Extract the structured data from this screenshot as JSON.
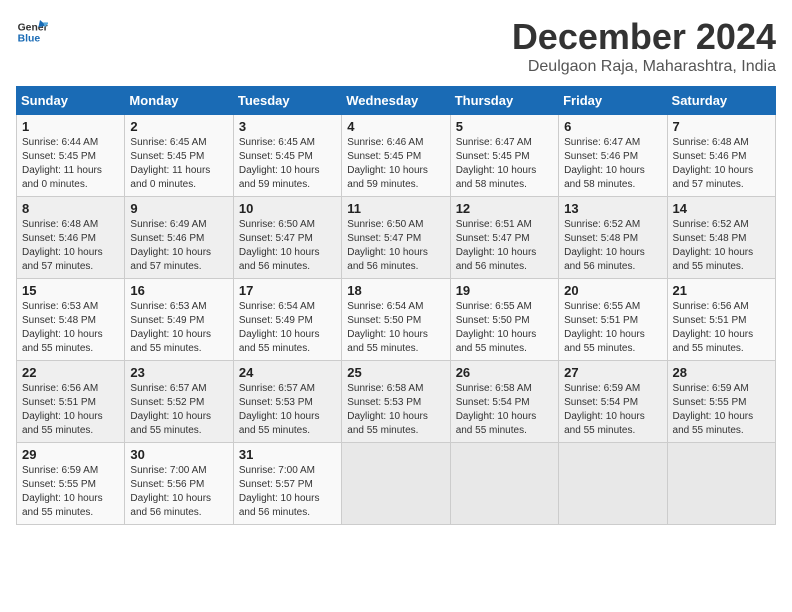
{
  "header": {
    "logo_line1": "General",
    "logo_line2": "Blue",
    "month_title": "December 2024",
    "location": "Deulgaon Raja, Maharashtra, India"
  },
  "days_of_week": [
    "Sunday",
    "Monday",
    "Tuesday",
    "Wednesday",
    "Thursday",
    "Friday",
    "Saturday"
  ],
  "weeks": [
    [
      {
        "day": "1",
        "info": "Sunrise: 6:44 AM\nSunset: 5:45 PM\nDaylight: 11 hours\nand 0 minutes."
      },
      {
        "day": "2",
        "info": "Sunrise: 6:45 AM\nSunset: 5:45 PM\nDaylight: 11 hours\nand 0 minutes."
      },
      {
        "day": "3",
        "info": "Sunrise: 6:45 AM\nSunset: 5:45 PM\nDaylight: 10 hours\nand 59 minutes."
      },
      {
        "day": "4",
        "info": "Sunrise: 6:46 AM\nSunset: 5:45 PM\nDaylight: 10 hours\nand 59 minutes."
      },
      {
        "day": "5",
        "info": "Sunrise: 6:47 AM\nSunset: 5:45 PM\nDaylight: 10 hours\nand 58 minutes."
      },
      {
        "day": "6",
        "info": "Sunrise: 6:47 AM\nSunset: 5:46 PM\nDaylight: 10 hours\nand 58 minutes."
      },
      {
        "day": "7",
        "info": "Sunrise: 6:48 AM\nSunset: 5:46 PM\nDaylight: 10 hours\nand 57 minutes."
      }
    ],
    [
      {
        "day": "8",
        "info": "Sunrise: 6:48 AM\nSunset: 5:46 PM\nDaylight: 10 hours\nand 57 minutes."
      },
      {
        "day": "9",
        "info": "Sunrise: 6:49 AM\nSunset: 5:46 PM\nDaylight: 10 hours\nand 57 minutes."
      },
      {
        "day": "10",
        "info": "Sunrise: 6:50 AM\nSunset: 5:47 PM\nDaylight: 10 hours\nand 56 minutes."
      },
      {
        "day": "11",
        "info": "Sunrise: 6:50 AM\nSunset: 5:47 PM\nDaylight: 10 hours\nand 56 minutes."
      },
      {
        "day": "12",
        "info": "Sunrise: 6:51 AM\nSunset: 5:47 PM\nDaylight: 10 hours\nand 56 minutes."
      },
      {
        "day": "13",
        "info": "Sunrise: 6:52 AM\nSunset: 5:48 PM\nDaylight: 10 hours\nand 56 minutes."
      },
      {
        "day": "14",
        "info": "Sunrise: 6:52 AM\nSunset: 5:48 PM\nDaylight: 10 hours\nand 55 minutes."
      }
    ],
    [
      {
        "day": "15",
        "info": "Sunrise: 6:53 AM\nSunset: 5:48 PM\nDaylight: 10 hours\nand 55 minutes."
      },
      {
        "day": "16",
        "info": "Sunrise: 6:53 AM\nSunset: 5:49 PM\nDaylight: 10 hours\nand 55 minutes."
      },
      {
        "day": "17",
        "info": "Sunrise: 6:54 AM\nSunset: 5:49 PM\nDaylight: 10 hours\nand 55 minutes."
      },
      {
        "day": "18",
        "info": "Sunrise: 6:54 AM\nSunset: 5:50 PM\nDaylight: 10 hours\nand 55 minutes."
      },
      {
        "day": "19",
        "info": "Sunrise: 6:55 AM\nSunset: 5:50 PM\nDaylight: 10 hours\nand 55 minutes."
      },
      {
        "day": "20",
        "info": "Sunrise: 6:55 AM\nSunset: 5:51 PM\nDaylight: 10 hours\nand 55 minutes."
      },
      {
        "day": "21",
        "info": "Sunrise: 6:56 AM\nSunset: 5:51 PM\nDaylight: 10 hours\nand 55 minutes."
      }
    ],
    [
      {
        "day": "22",
        "info": "Sunrise: 6:56 AM\nSunset: 5:51 PM\nDaylight: 10 hours\nand 55 minutes."
      },
      {
        "day": "23",
        "info": "Sunrise: 6:57 AM\nSunset: 5:52 PM\nDaylight: 10 hours\nand 55 minutes."
      },
      {
        "day": "24",
        "info": "Sunrise: 6:57 AM\nSunset: 5:53 PM\nDaylight: 10 hours\nand 55 minutes."
      },
      {
        "day": "25",
        "info": "Sunrise: 6:58 AM\nSunset: 5:53 PM\nDaylight: 10 hours\nand 55 minutes."
      },
      {
        "day": "26",
        "info": "Sunrise: 6:58 AM\nSunset: 5:54 PM\nDaylight: 10 hours\nand 55 minutes."
      },
      {
        "day": "27",
        "info": "Sunrise: 6:59 AM\nSunset: 5:54 PM\nDaylight: 10 hours\nand 55 minutes."
      },
      {
        "day": "28",
        "info": "Sunrise: 6:59 AM\nSunset: 5:55 PM\nDaylight: 10 hours\nand 55 minutes."
      }
    ],
    [
      {
        "day": "29",
        "info": "Sunrise: 6:59 AM\nSunset: 5:55 PM\nDaylight: 10 hours\nand 55 minutes."
      },
      {
        "day": "30",
        "info": "Sunrise: 7:00 AM\nSunset: 5:56 PM\nDaylight: 10 hours\nand 56 minutes."
      },
      {
        "day": "31",
        "info": "Sunrise: 7:00 AM\nSunset: 5:57 PM\nDaylight: 10 hours\nand 56 minutes."
      },
      {
        "day": "",
        "info": ""
      },
      {
        "day": "",
        "info": ""
      },
      {
        "day": "",
        "info": ""
      },
      {
        "day": "",
        "info": ""
      }
    ]
  ]
}
